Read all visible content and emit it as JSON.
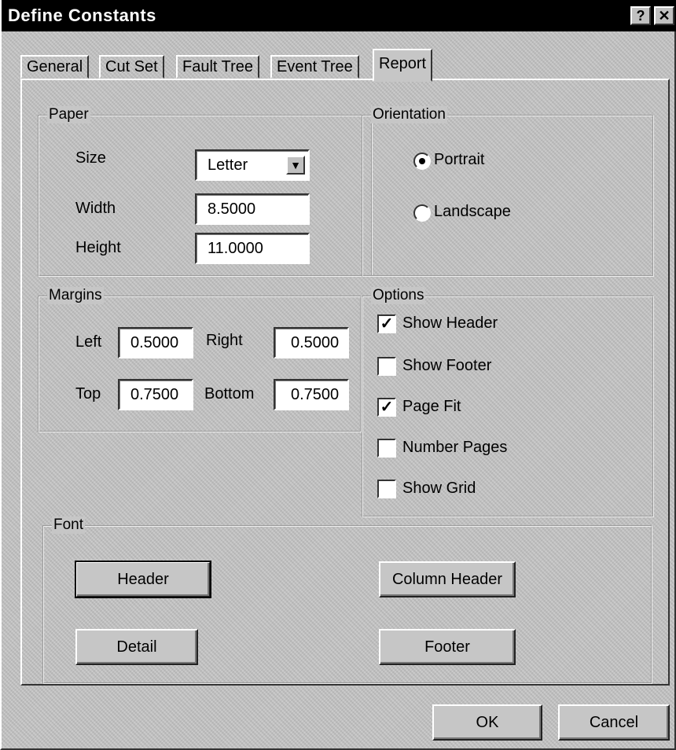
{
  "window": {
    "title": "Define Constants",
    "help_label": "?",
    "close_label": "✕"
  },
  "tabs": [
    {
      "label": "General"
    },
    {
      "label": "Cut Set"
    },
    {
      "label": "Fault Tree"
    },
    {
      "label": "Event Tree"
    },
    {
      "label": "Report",
      "active": true
    }
  ],
  "paper": {
    "group_label": "Paper",
    "size_label": "Size",
    "size_value": "Letter",
    "width_label": "Width",
    "width_value": "8.5000",
    "height_label": "Height",
    "height_value": "11.0000"
  },
  "orientation": {
    "group_label": "Orientation",
    "portrait_label": "Portrait",
    "landscape_label": "Landscape",
    "selected": "Portrait"
  },
  "margins": {
    "group_label": "Margins",
    "left_label": "Left",
    "left_value": "0.5000",
    "right_label": "Right",
    "right_value": "0.5000",
    "top_label": "Top",
    "top_value": "0.7500",
    "bottom_label": "Bottom",
    "bottom_value": "0.7500"
  },
  "options": {
    "group_label": "Options",
    "items": [
      {
        "label": "Show Header",
        "checked": true
      },
      {
        "label": "Show Footer",
        "checked": false
      },
      {
        "label": "Page Fit",
        "checked": true
      },
      {
        "label": "Number Pages",
        "checked": false
      },
      {
        "label": "Show Grid",
        "checked": false
      }
    ]
  },
  "font": {
    "group_label": "Font",
    "header_button": "Header",
    "column_header_button": "Column Header",
    "detail_button": "Detail",
    "footer_button": "Footer"
  },
  "buttons": {
    "ok": "OK",
    "cancel": "Cancel"
  }
}
